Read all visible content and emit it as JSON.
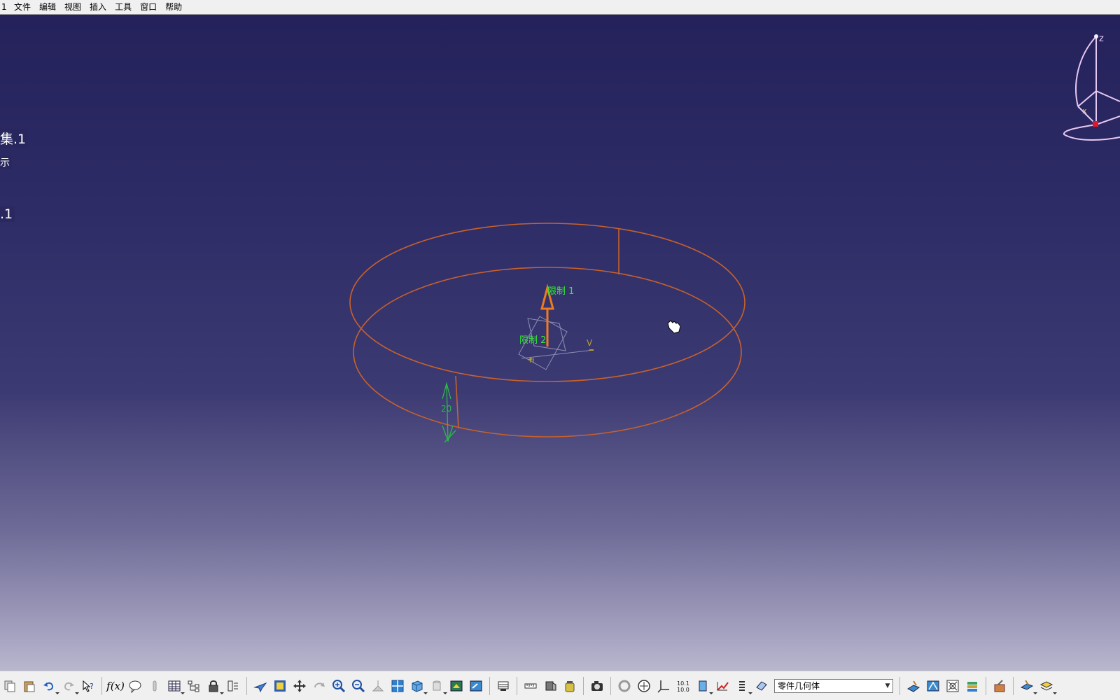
{
  "menubar": {
    "edge_text": "1",
    "items": [
      {
        "label": "文件"
      },
      {
        "label": "编辑"
      },
      {
        "label": "视图"
      },
      {
        "label": "插入"
      },
      {
        "label": "工具"
      },
      {
        "label": "窗口"
      },
      {
        "label": "帮助"
      }
    ]
  },
  "tree_fragments": [
    "集.1",
    "示",
    ".1"
  ],
  "viewport": {
    "limit1_label": "限制 1",
    "limit2_label": "限制 2",
    "dimension_value": "20",
    "axis_v": "V",
    "axis_h": "H",
    "compass_z": "z",
    "compass_x": "x"
  },
  "toolbar": {
    "selector_value": "零件几何体",
    "icons": [
      "copy-icon",
      "paste-icon",
      "undo-icon",
      "redo-icon",
      "whats-this-icon",
      "formula-icon",
      "knowledge-icon",
      "light-icon",
      "table-icon",
      "tree-icon",
      "lock-icon",
      "catalog-icon",
      "fly-icon",
      "fit-all-icon",
      "pan-icon",
      "rotate-icon",
      "zoom-in-icon",
      "zoom-out-icon",
      "normal-view-icon",
      "multi-view-icon",
      "iso-view-icon",
      "shading-icon",
      "hide-show-icon",
      "swap-space-icon",
      "grid-icon",
      "measure-icon",
      "inertia-icon",
      "weight-icon",
      "capture-icon",
      "update-icon",
      "manipulate-icon",
      "axis-system-icon",
      "decimal-icon",
      "plane-icon",
      "trace-icon",
      "list-icon",
      "body-icon"
    ]
  },
  "colors": {
    "wireframe": "#c8612c",
    "limit_label": "#37e637",
    "dimension": "#2db84a",
    "compass": "#e6c8f0"
  }
}
